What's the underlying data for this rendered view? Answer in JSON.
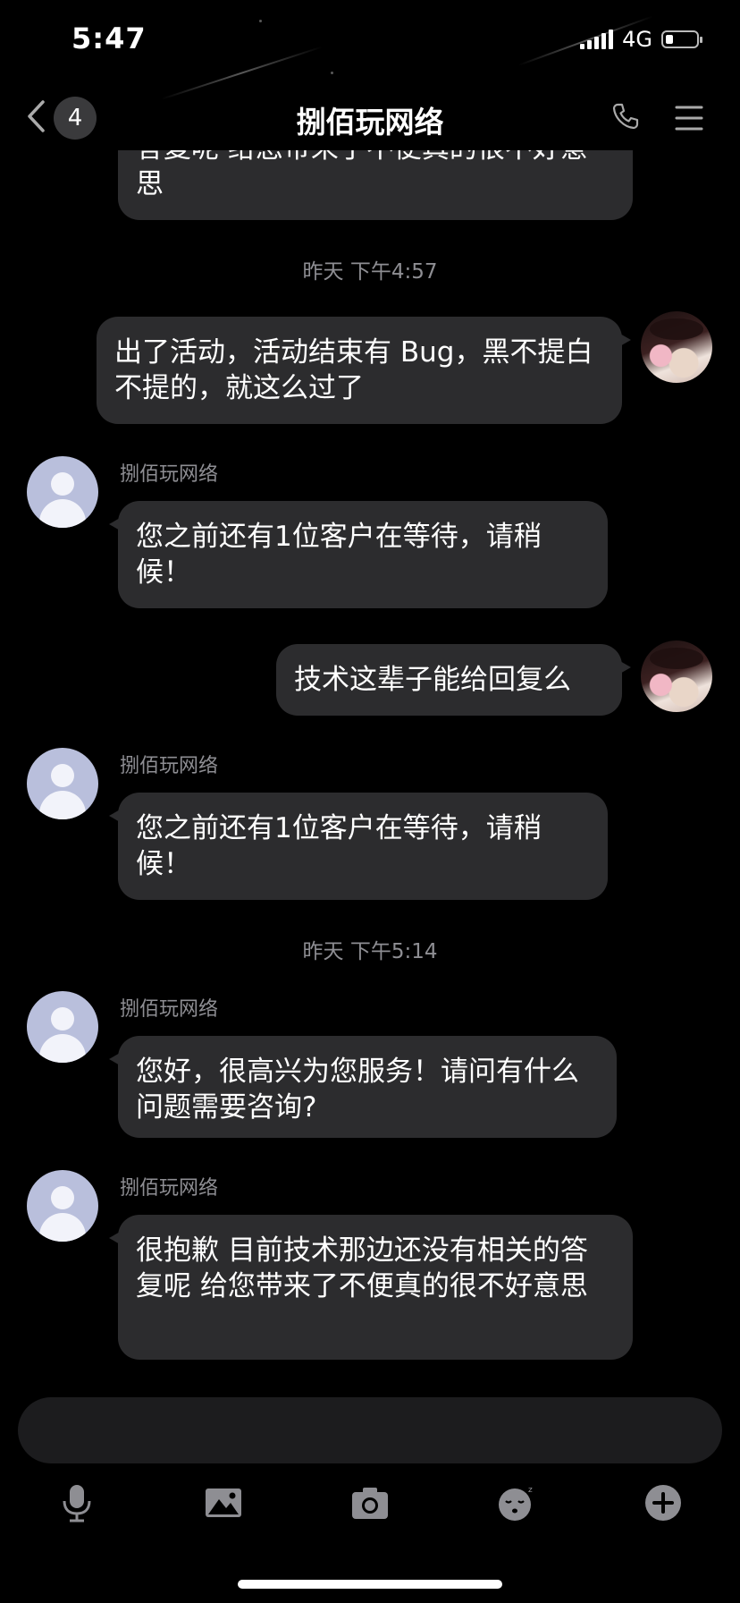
{
  "status": {
    "time": "5:47",
    "network": "4G",
    "battery_level": 0.25
  },
  "header": {
    "back_badge": "4",
    "title": "捌佰玩网络"
  },
  "messages": {
    "m0": {
      "text": "答复呢  给您带来了不便真的很不好意思"
    },
    "t1": "昨天 下午4:57",
    "m1": {
      "text": "出了活动，活动结束有 Bug，黑不提白不提的，就这么过了"
    },
    "m2": {
      "sender": "捌佰玩网络",
      "text": "您之前还有1位客户在等待，请稍候！"
    },
    "m3": {
      "text": "技术这辈子能给回复么"
    },
    "m4": {
      "sender": "捌佰玩网络",
      "text": "您之前还有1位客户在等待，请稍候！"
    },
    "t2": "昨天 下午5:14",
    "m5": {
      "sender": "捌佰玩网络",
      "text": "您好，很高兴为您服务！请问有什么问题需要咨询?"
    },
    "m6": {
      "sender": "捌佰玩网络",
      "text": "很抱歉 目前技术那边还没有相关的答复呢  给您带来了不便真的很不好意思"
    }
  },
  "input": {
    "placeholder": ""
  },
  "toolbar": [
    "microphone-icon",
    "image-icon",
    "camera-icon",
    "sticker-icon",
    "plus-icon"
  ],
  "colors": {
    "background": "#000000",
    "bubble": "#2c2c2e",
    "meta_text": "#8e8e93",
    "cs_avatar": "#b9bfdc"
  }
}
